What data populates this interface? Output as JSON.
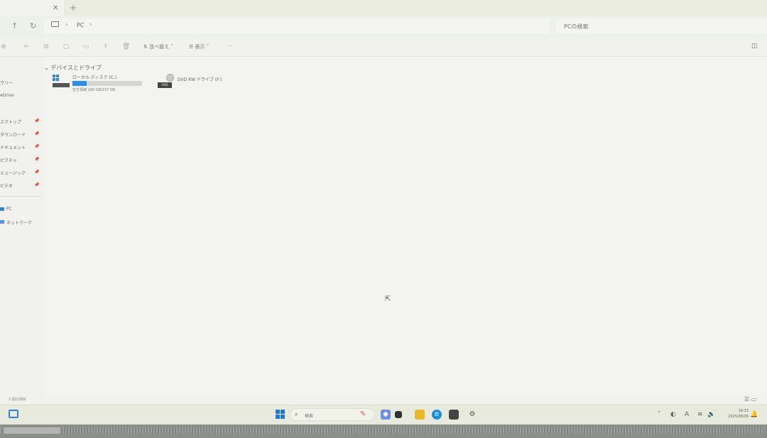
{
  "tabs": {
    "close_glyph": "✕",
    "add_glyph": "+"
  },
  "address": {
    "breadcrumb": [
      "PC"
    ],
    "search_placeholder": "PCの検索"
  },
  "commandbar": {
    "sort_label": "並べ替え",
    "view_label": "表示",
    "more_label": "···"
  },
  "sidebar": {
    "items_top": [
      "ラリー",
      "eDrive"
    ],
    "quick_access": [
      {
        "label": "スクトップ"
      },
      {
        "label": "ダウンロード"
      },
      {
        "label": "ドキュメント"
      },
      {
        "label": "ピクチャ"
      },
      {
        "label": "ミュージック"
      },
      {
        "label": "ビデオ"
      }
    ],
    "pc_label": "PC",
    "network_label": "ネットワーク"
  },
  "content": {
    "group_header": "デバイスとドライブ",
    "drive_c": {
      "name": "ローカル ディスク (C:)",
      "free_text": "空き領域 190 GB/237 GB",
      "usage_fraction": 0.2
    },
    "drive_dvd": {
      "name": "DVD RW ドライブ (F:)",
      "badge": "DVD"
    }
  },
  "status": {
    "item_count": "2 個の項目"
  },
  "taskbar": {
    "search_label": "検索",
    "time": "18:33",
    "date": "2025/08/28"
  },
  "colors": {
    "accent": "#2e8fde",
    "background": "#f3f4f1"
  }
}
